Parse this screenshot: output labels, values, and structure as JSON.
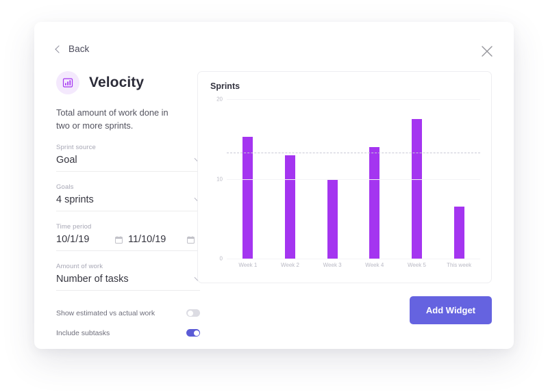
{
  "header": {
    "back_label": "Back",
    "close_icon": "close-icon"
  },
  "widget": {
    "icon": "bar-chart-icon",
    "title": "Velocity",
    "description": "Total amount of work done in two or more sprints."
  },
  "form": {
    "sprint_source": {
      "label": "Sprint source",
      "value": "Goal",
      "chevron": "chevron-down-icon"
    },
    "goals": {
      "label": "Goals",
      "value": "4 sprints",
      "chevron": "chevron-down-icon"
    },
    "time_period": {
      "label": "Time period",
      "start": "10/1/19",
      "end": "11/10/19",
      "calendar_icon": "calendar-icon"
    },
    "amount_of_work": {
      "label": "Amount of work",
      "value": "Number of tasks",
      "chevron": "chevron-down-icon"
    },
    "toggles": [
      {
        "label": "Show estimated vs actual work",
        "on": false
      },
      {
        "label": "Include subtasks",
        "on": true
      }
    ]
  },
  "footer": {
    "add_widget_label": "Add Widget"
  },
  "colors": {
    "bar": "#a435f0",
    "accent_button": "#6563e0",
    "toggle_on": "#5b5bd6",
    "toggle_off": "#dcdce3",
    "icon_bg": "#f4e9fd"
  },
  "chart_data": {
    "type": "bar",
    "title": "Sprints",
    "xlabel": "",
    "ylabel": "",
    "categories": [
      "Week 1",
      "Week 2",
      "Week 3",
      "Week 4",
      "Week 5",
      "This week"
    ],
    "values": [
      15.3,
      13,
      10,
      14,
      17.5,
      6.5
    ],
    "ylim": [
      0,
      20
    ],
    "yticks": [
      0,
      10,
      20
    ],
    "grid": true,
    "legend": "none",
    "annotations": [
      {
        "type": "average-line",
        "value": 13.3,
        "style": "dashed"
      }
    ]
  }
}
